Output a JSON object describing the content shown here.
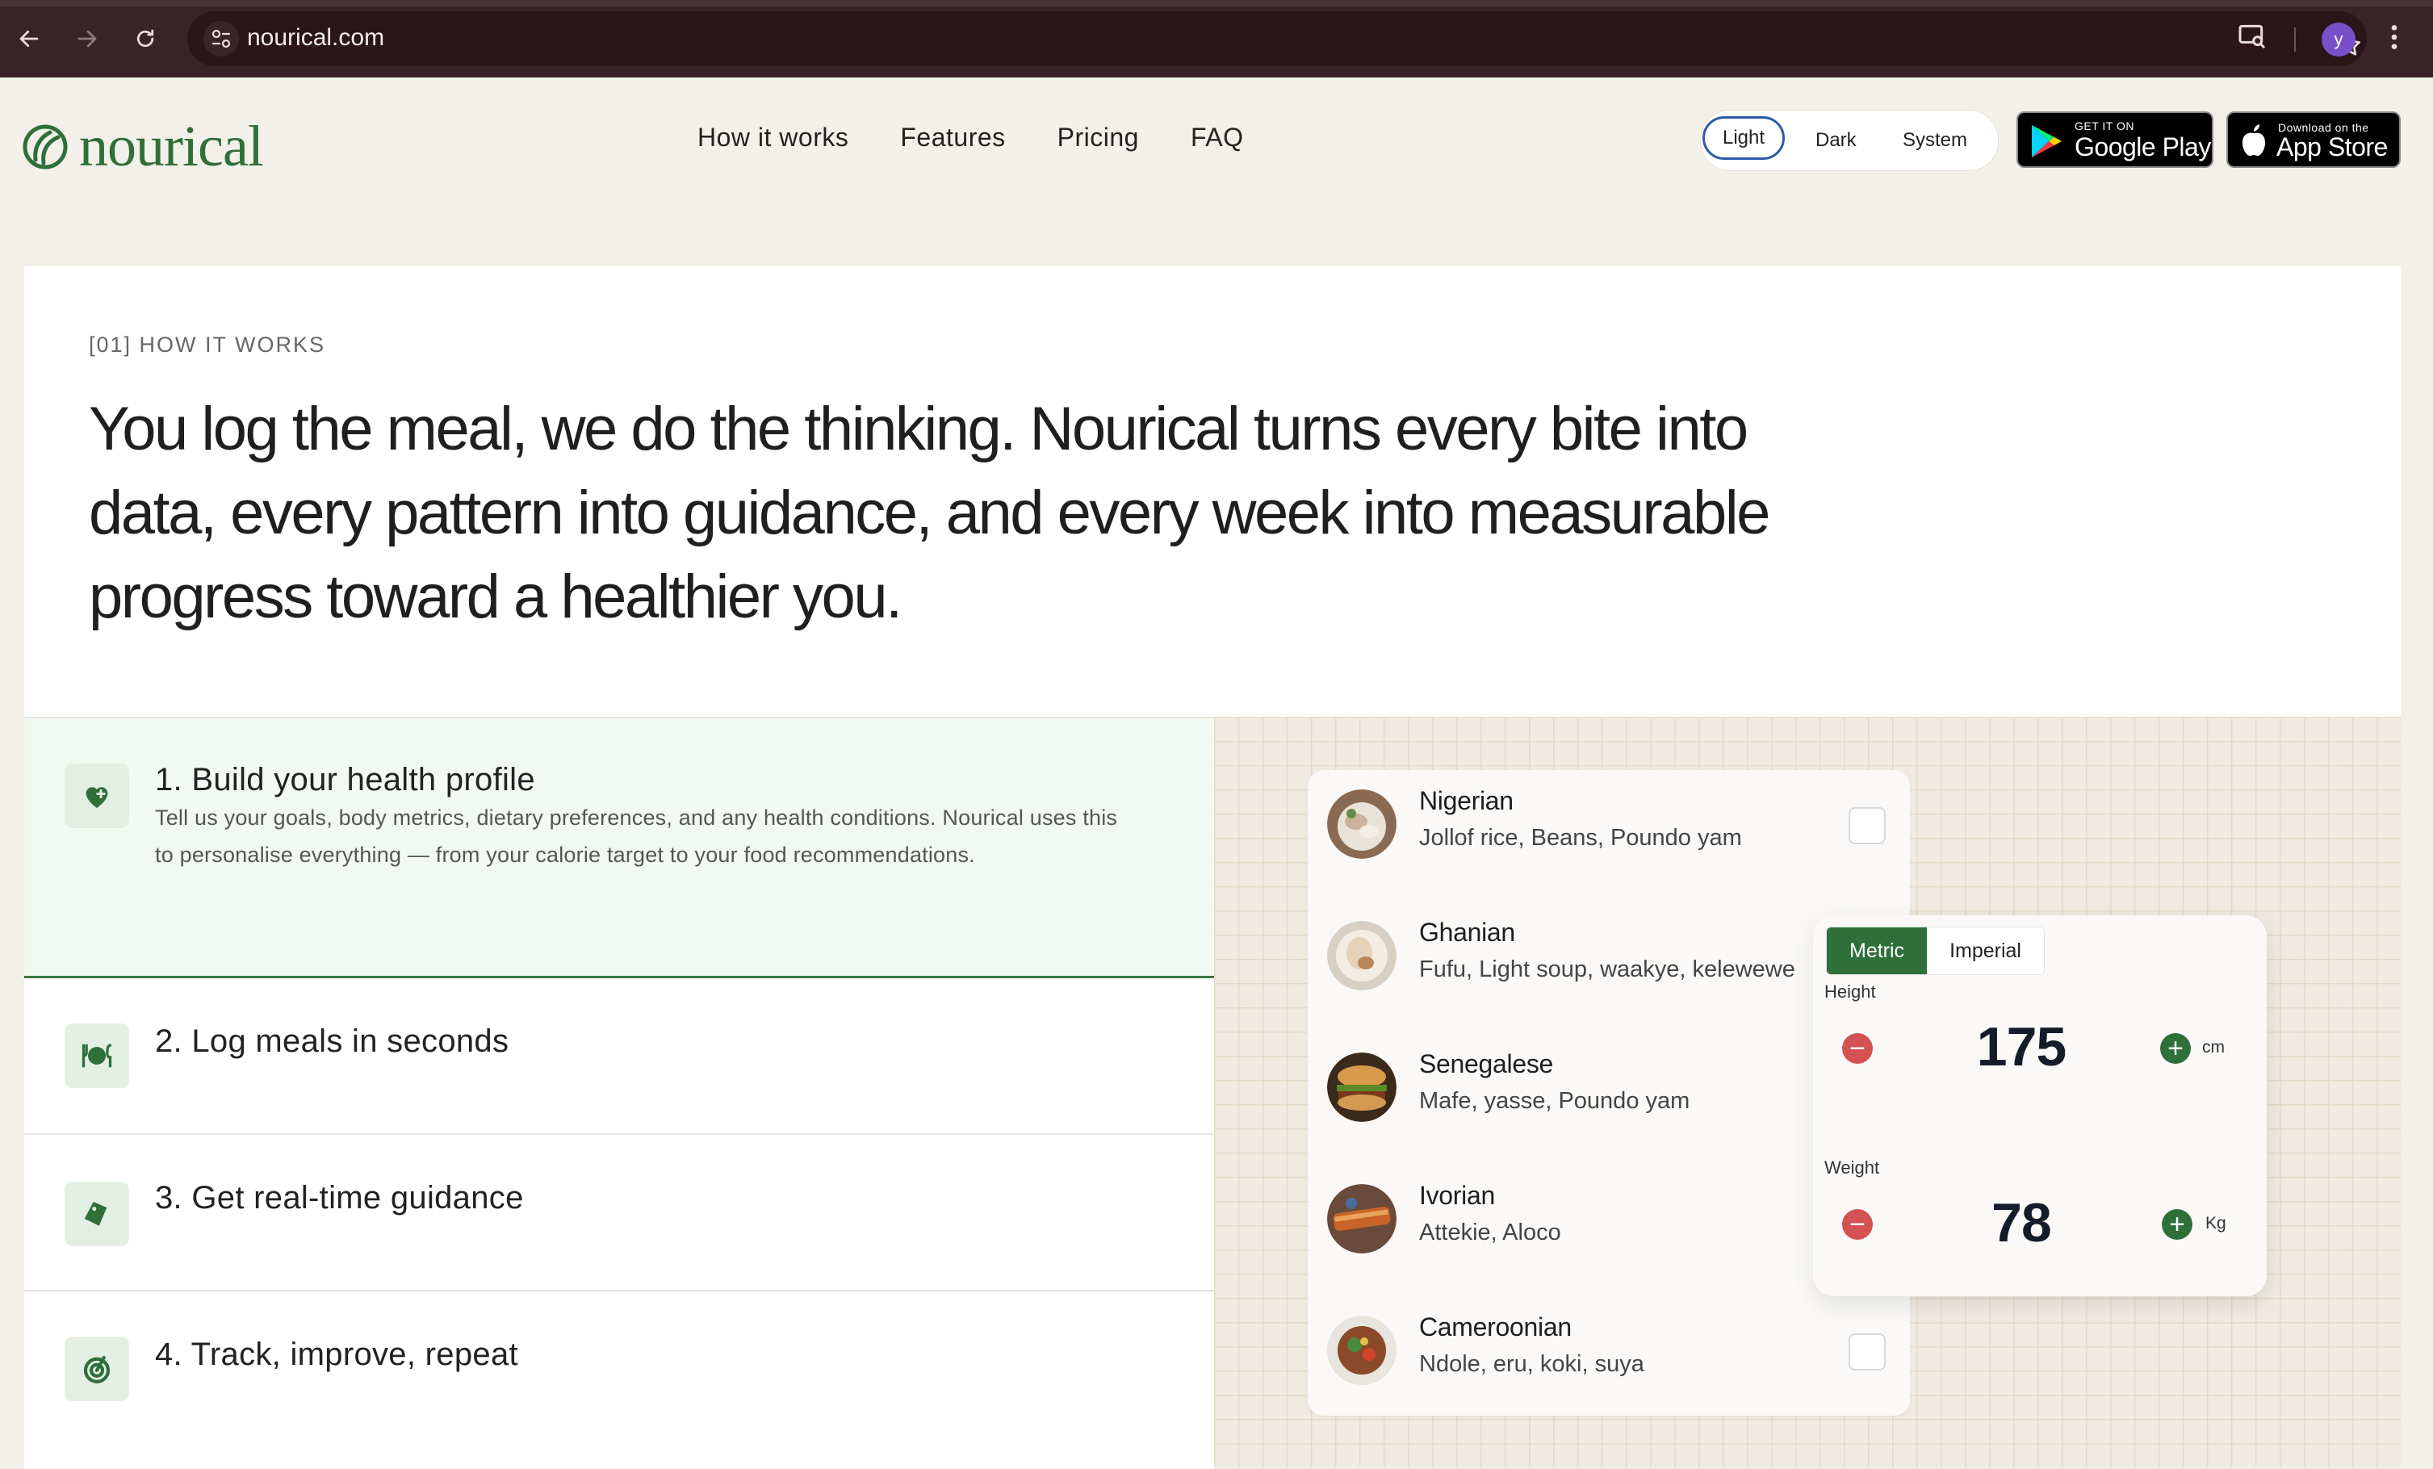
{
  "browser": {
    "url": "nourical.com",
    "profile_initial": "y"
  },
  "header": {
    "brand": "nourical",
    "nav": [
      "How it works",
      "Features",
      "Pricing",
      "FAQ"
    ],
    "theme_options": [
      "Light",
      "Dark",
      "System"
    ],
    "theme_selected": "Light",
    "google_play": {
      "small": "GET IT ON",
      "big": "Google Play"
    },
    "app_store": {
      "small": "Download on the",
      "big": "App Store"
    }
  },
  "hero": {
    "eyebrow": "[01] HOW IT WORKS",
    "headline": "You log the meal, we do the thinking. Nourical turns every bite into data, every pattern into guidance, and every week into measurable progress toward a healthier you."
  },
  "steps": [
    {
      "title": "1. Build your health profile",
      "description": "Tell us your goals, body metrics, dietary preferences, and any health conditions. Nourical uses this to personalise everything — from your calorie target to your food recommendations.",
      "icon": "heart-plus-icon",
      "active": true
    },
    {
      "title": "2. Log meals in seconds",
      "description": "",
      "icon": "plate-cutlery-icon",
      "active": false
    },
    {
      "title": "3. Get real-time guidance",
      "description": "",
      "icon": "guidance-tag-icon",
      "active": false
    },
    {
      "title": "4. Track, improve, repeat",
      "description": "",
      "icon": "target-icon",
      "active": false
    }
  ],
  "cuisines": [
    {
      "name": "Nigerian",
      "dishes": "Jollof rice, Beans, Poundo yam"
    },
    {
      "name": "Ghanian",
      "dishes": "Fufu, Light soup, waakye, kelewewe"
    },
    {
      "name": "Senegalese",
      "dishes": "Mafe, yasse, Poundo yam"
    },
    {
      "name": "Ivorian",
      "dishes": "Attekie, Aloco"
    },
    {
      "name": "Cameroonian",
      "dishes": "Ndole, eru, koki, suya"
    }
  ],
  "metrics": {
    "units": [
      "Metric",
      "Imperial"
    ],
    "unit_selected": "Metric",
    "height": {
      "label": "Height",
      "value": "175",
      "unit": "cm"
    },
    "weight": {
      "label": "Weight",
      "value": "78",
      "unit": "Kg"
    }
  },
  "colors": {
    "brand_green": "#2f6f3a",
    "minus_red": "#d45252",
    "chrome": "#3a2328",
    "page_bg": "#f3f0ea"
  }
}
